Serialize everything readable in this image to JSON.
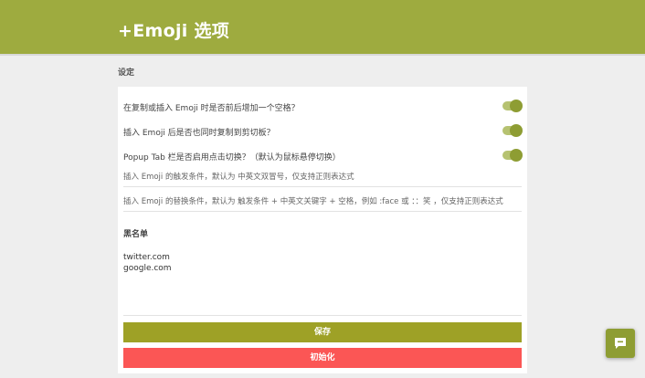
{
  "header": {
    "title": "+Emoji 选项"
  },
  "settings": {
    "section_title": "设定",
    "toggles": [
      {
        "label": "在复制或插入 Emoji 时是否前后增加一个空格？",
        "on": true
      },
      {
        "label": "插入 Emoji 后是否也同时复制到剪切板？",
        "on": true
      },
      {
        "label": "Popup Tab 栏是否启用点击切换？（默认为鼠标悬停切换）",
        "on": true
      }
    ],
    "trigger_placeholder": "插入 Emoji 的触发条件，默认为 中英文双冒号，仅支持正则表达式",
    "replace_placeholder": "插入 Emoji 的替换条件，默认为 触发条件 + 中英文关键字 + 空格，例如 :face 或 ：：笑 ，仅支持正则表达式",
    "blacklist_title": "黑名单",
    "blacklist_value": "twitter.com\ngoogle.com",
    "save_label": "保存",
    "reset_label": "初始化"
  },
  "colors": {
    "header_bg": "#9eab3f",
    "toggle_on": "#8e9d33",
    "save_bg": "#9ea126",
    "reset_bg": "#fb5655"
  },
  "icons": {
    "fab": "chat-bubble-icon"
  }
}
